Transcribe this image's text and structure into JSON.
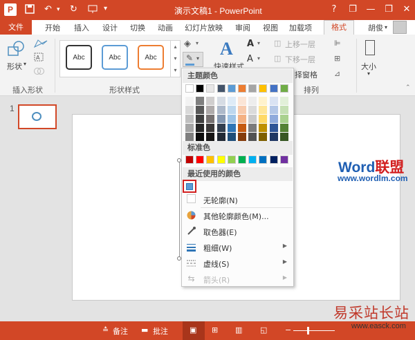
{
  "app": {
    "logo": "P",
    "title": "演示文稿1 - PowerPoint"
  },
  "qat": {
    "save_icon": "save-icon",
    "undo_icon": "undo-icon",
    "redo_icon": "redo-icon",
    "present_icon": "present-icon"
  },
  "window": {
    "help": "?",
    "minimize": "—",
    "restore": "❐",
    "close": "✕"
  },
  "tabs": [
    "开始",
    "插入",
    "设计",
    "切换",
    "动画",
    "幻灯片放映",
    "审阅",
    "视图",
    "加载项"
  ],
  "file_tab": "文件",
  "format_tab": "格式",
  "user": "胡俊",
  "ribbon": {
    "shape_label": "形状",
    "group_insert_shapes": "插入形状",
    "group_shape_styles": "形状样式",
    "group_arrange": "排列",
    "style_samples": [
      "Abc",
      "Abc",
      "Abc"
    ],
    "quick_styles": "快速样式",
    "bring_forward": "上移一层",
    "send_backward": "下移一层",
    "selection_pane": "择窗格",
    "size": "大小"
  },
  "slides": {
    "number": "1"
  },
  "menu": {
    "theme_colors_header": "主题颜色",
    "standard_colors_header": "标准色",
    "recent_colors_header": "最近使用的颜色",
    "no_outline": "无轮廓(N)",
    "more_colors": "其他轮廓颜色(M)...",
    "eyedropper": "取色器(E)",
    "weight": "粗细(W)",
    "dashes": "虚线(S)",
    "arrows": "箭头(R)",
    "theme_top": [
      "#ffffff",
      "#000000",
      "#e7e6e6",
      "#44546a",
      "#5b9bd5",
      "#ed7d31",
      "#a5a5a5",
      "#ffc000",
      "#4472c4",
      "#70ad47"
    ],
    "theme_cols": [
      [
        "#f2f2f2",
        "#d9d9d9",
        "#bfbfbf",
        "#a6a6a6",
        "#808080"
      ],
      [
        "#7f7f7f",
        "#595959",
        "#3f3f3f",
        "#262626",
        "#0d0d0d"
      ],
      [
        "#d0cece",
        "#afabab",
        "#767171",
        "#3a3838",
        "#171616"
      ],
      [
        "#d6dce4",
        "#adb9ca",
        "#8497b0",
        "#333f4f",
        "#222a35"
      ],
      [
        "#deebf7",
        "#bdd7ee",
        "#9dc3e6",
        "#2e75b6",
        "#1f4e79"
      ],
      [
        "#fbe5d6",
        "#f8cbad",
        "#f4b183",
        "#c55a11",
        "#843c0c"
      ],
      [
        "#ededed",
        "#dbdbdb",
        "#c9c9c9",
        "#7b7b7b",
        "#525252"
      ],
      [
        "#fff2cc",
        "#ffe699",
        "#ffd966",
        "#bf9000",
        "#7f6000"
      ],
      [
        "#dae3f3",
        "#b4c7e7",
        "#8faadc",
        "#2f5597",
        "#203864"
      ],
      [
        "#e2f0d9",
        "#c5e0b4",
        "#a9d18e",
        "#548235",
        "#385723"
      ]
    ],
    "standard": [
      "#c00000",
      "#ff0000",
      "#ffc000",
      "#ffff00",
      "#92d050",
      "#00b050",
      "#00b0f0",
      "#0070c0",
      "#002060",
      "#7030a0"
    ],
    "recent": [
      "#5b9bd5"
    ]
  },
  "status": {
    "notes": "备注",
    "comments": "批注"
  },
  "watermark": {
    "brand_word": "Word",
    "brand_cn": "联盟",
    "brand_url": "www.wordlm.com",
    "site_cn": "易采站长站",
    "site_url": "www.easck.com"
  }
}
